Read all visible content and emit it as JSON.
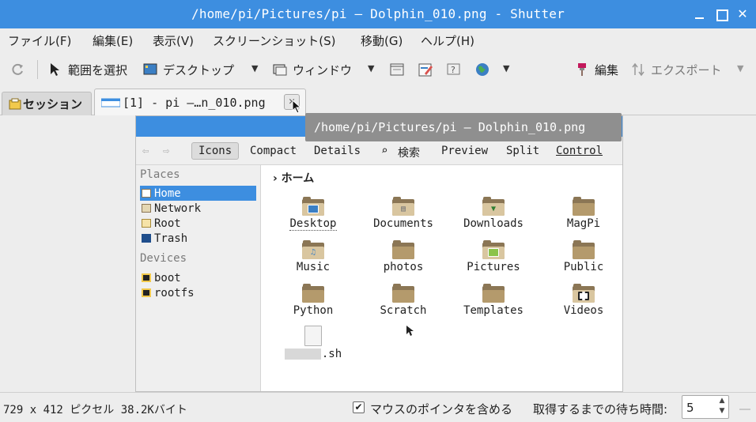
{
  "window": {
    "title": "/home/pi/Pictures/pi — Dolphin_010.png - Shutter",
    "title_bg": "#3d8ee0"
  },
  "menu": [
    "ファイル(F)",
    "編集(E)",
    "表示(V)",
    "スクリーンショット(S)",
    "移動(G)",
    "ヘルプ(H)"
  ],
  "toolbar": {
    "selection_label": "範囲を選択",
    "desktop_label": "デスクトップ",
    "window_label": "ウィンドウ",
    "edit_label": "編集",
    "export_label": "エクスポート"
  },
  "tabs": {
    "session_label": "セッション",
    "image_label": "[1] - pi —…n_010.png",
    "close_glyph": "✕"
  },
  "tooltip": "/home/pi/Pictures/pi — Dolphin_010.png",
  "screenshot": {
    "toolbar": {
      "icons": "Icons",
      "compact": "Compact",
      "details": "Details",
      "search": "検索",
      "preview": "Preview",
      "split": "Split",
      "control": "Control"
    },
    "places_heading": "Places",
    "places": [
      "Home",
      "Network",
      "Root",
      "Trash"
    ],
    "devices_heading": "Devices",
    "devices": [
      "boot",
      "rootfs"
    ],
    "breadcrumb": "ホーム",
    "files": [
      "Desktop",
      "Documents",
      "Downloads",
      "MagPi",
      "Music",
      "photos",
      "Pictures",
      "Public",
      "Python",
      "Scratch",
      "Templates",
      "Videos"
    ],
    "script_suffix": ".sh"
  },
  "status": {
    "dimensions": "729 x 412 ピクセル  38.2Kバイト",
    "include_pointer_label": "マウスのポインタを含める",
    "include_pointer_checked": true,
    "checkmark": "✔",
    "delay_label": "取得するまでの待ち時間:",
    "delay_value": "5"
  }
}
